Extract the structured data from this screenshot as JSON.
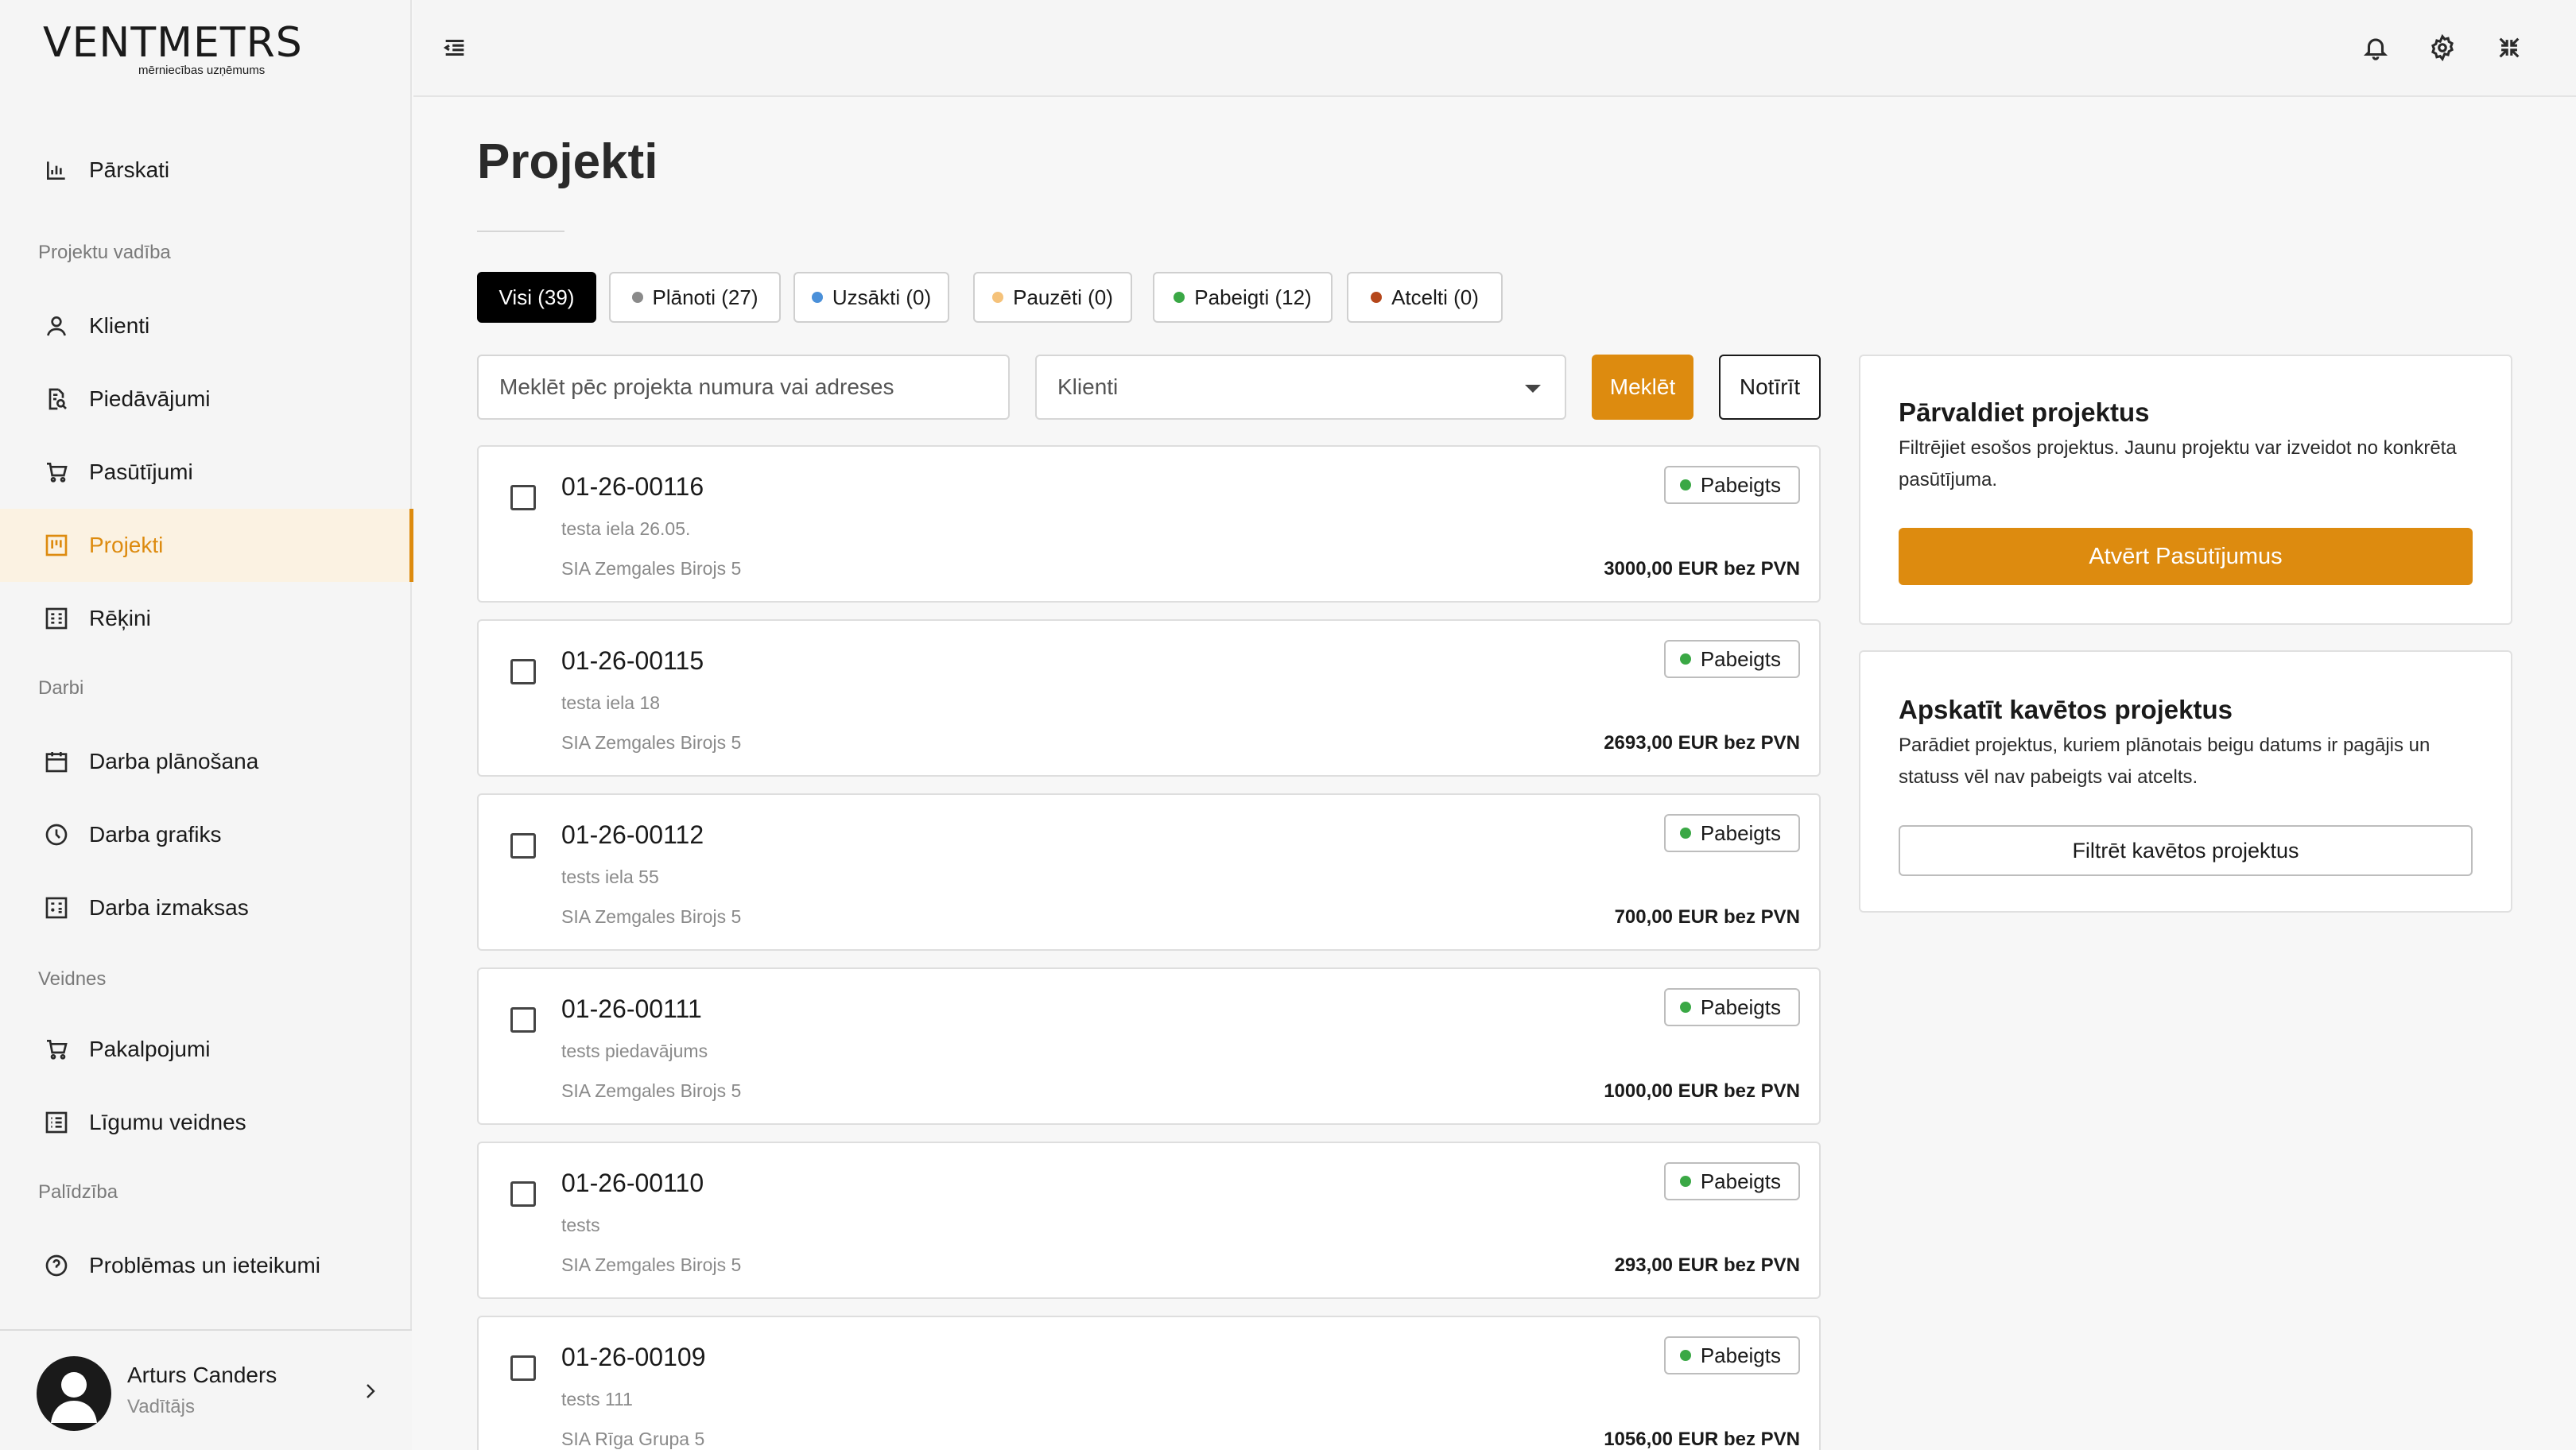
{
  "brand": {
    "name": "VENTMETRS",
    "tagline": "mērniecības uzņēmums"
  },
  "sidebar": {
    "items": [
      {
        "label": "Pārskati",
        "icon": "bar-chart-icon"
      },
      {
        "label": "Klienti",
        "icon": "user-icon"
      },
      {
        "label": "Piedāvājumi",
        "icon": "document-search-icon"
      },
      {
        "label": "Pasūtījumi",
        "icon": "cart-icon"
      },
      {
        "label": "Projekti",
        "icon": "kanban-icon",
        "active": true
      },
      {
        "label": "Rēķini",
        "icon": "invoice-icon"
      },
      {
        "label": "Darba plānošana",
        "icon": "calendar-icon"
      },
      {
        "label": "Darba grafiks",
        "icon": "clock-icon"
      },
      {
        "label": "Darba izmaksas",
        "icon": "calculator-icon"
      },
      {
        "label": "Pakalpojumi",
        "icon": "cart-icon"
      },
      {
        "label": "Līgumu veidnes",
        "icon": "list-icon"
      },
      {
        "label": "Problēmas un ieteikumi",
        "icon": "help-circle-icon"
      }
    ],
    "sections": {
      "project_management": "Projektu vadība",
      "work": "Darbi",
      "templates": "Veidnes",
      "help": "Palīdzība"
    },
    "user": {
      "name": "Arturs Canders",
      "role": "Vadītājs"
    }
  },
  "topbar": {
    "icons": [
      "menu-collapse-icon",
      "bell-icon",
      "gear-icon",
      "fullscreen-exit-icon"
    ]
  },
  "page": {
    "title": "Projekti"
  },
  "tabs": [
    {
      "label": "Visi (39)",
      "active": true
    },
    {
      "label": "Plānoti (27)",
      "dot": "#8a8a8a"
    },
    {
      "label": "Uzsākti (0)",
      "dot": "#4a90d9"
    },
    {
      "label": "Pauzēti (0)",
      "dot": "#f5c27a"
    },
    {
      "label": "Pabeigti (12)",
      "dot": "#3aa845"
    },
    {
      "label": "Atcelti (0)",
      "dot": "#b5471b"
    }
  ],
  "filters": {
    "search_placeholder": "Meklēt pēc projekta numura vai adreses",
    "client_select": "Klienti",
    "search_button": "Meklēt",
    "clear_button": "Notīrīt"
  },
  "projects": [
    {
      "number": "01-26-00116",
      "address": "testa iela 26.05.",
      "client": "SIA Zemgales Birojs 5",
      "status": "Pabeigts",
      "price": "3000,00 EUR bez PVN"
    },
    {
      "number": "01-26-00115",
      "address": "testa iela 18",
      "client": "SIA Zemgales Birojs 5",
      "status": "Pabeigts",
      "price": "2693,00 EUR bez PVN"
    },
    {
      "number": "01-26-00112",
      "address": "tests iela 55",
      "client": "SIA Zemgales Birojs 5",
      "status": "Pabeigts",
      "price": "700,00 EUR bez PVN"
    },
    {
      "number": "01-26-00111",
      "address": "tests piedavājums",
      "client": "SIA Zemgales Birojs 5",
      "status": "Pabeigts",
      "price": "1000,00 EUR bez PVN"
    },
    {
      "number": "01-26-00110",
      "address": "tests",
      "client": "SIA Zemgales Birojs 5",
      "status": "Pabeigts",
      "price": "293,00 EUR bez PVN"
    },
    {
      "number": "01-26-00109",
      "address": "tests 111",
      "client": "SIA Rīga Grupa 5",
      "status": "Pabeigts",
      "price": "1056,00 EUR bez PVN"
    }
  ],
  "manage_card": {
    "title": "Pārvaldiet projektus",
    "text": "Filtrējiet esošos projektus. Jaunu projektu var izveidot no konkrēta pasūtījuma.",
    "button": "Atvērt Pasūtījumus"
  },
  "overdue_card": {
    "title": "Apskatīt kavētos projektus",
    "text": "Parādiet projektus, kuriem plānotais beigu datums ir pagājis un statuss vēl nav pabeigts vai atcelts.",
    "button": "Filtrēt kavētos projektus"
  },
  "colors": {
    "accent": "#dd8b0f",
    "status_done": "#3aa845"
  }
}
